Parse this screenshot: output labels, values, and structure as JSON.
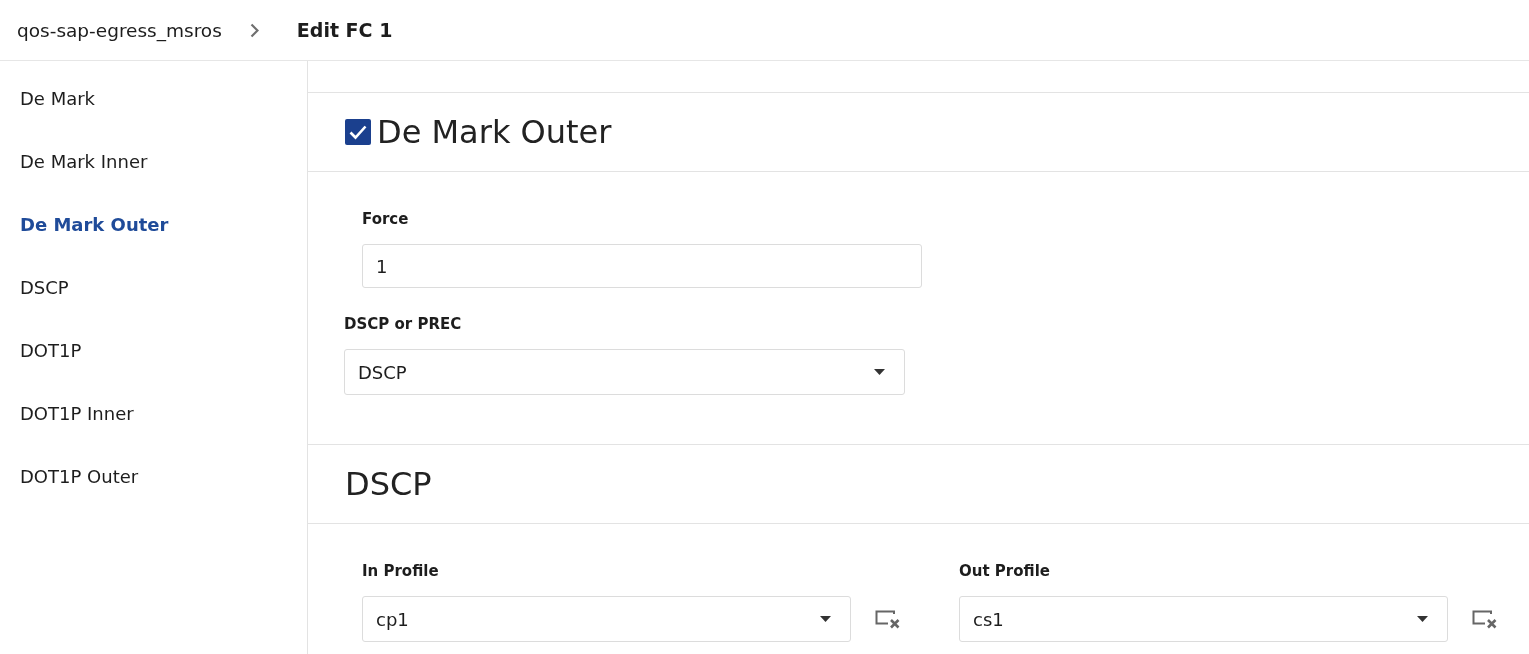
{
  "breadcrumb": {
    "parent": "qos-sap-egress_msros",
    "current": "Edit FC 1"
  },
  "sidebar": {
    "items": [
      {
        "label": "De Mark",
        "selected": false
      },
      {
        "label": "De Mark Inner",
        "selected": false
      },
      {
        "label": "De Mark Outer",
        "selected": true
      },
      {
        "label": "DSCP",
        "selected": false
      },
      {
        "label": "DOT1P",
        "selected": false
      },
      {
        "label": "DOT1P Inner",
        "selected": false
      },
      {
        "label": "DOT1P Outer",
        "selected": false
      }
    ]
  },
  "sections": [
    {
      "kind": "checkbox",
      "title": "De Mark Outer",
      "checked": true,
      "fields": [
        {
          "kind": "text",
          "label": "Force",
          "value": "1"
        },
        {
          "kind": "select",
          "label": "DSCP or PREC",
          "value": "DSCP"
        }
      ]
    },
    {
      "kind": "plain",
      "title": "DSCP",
      "fields": [
        {
          "kind": "clearable_select",
          "label": "In Profile",
          "value": "cp1"
        },
        {
          "kind": "clearable_select",
          "label": "Out Profile",
          "value": "cs1"
        }
      ]
    }
  ]
}
